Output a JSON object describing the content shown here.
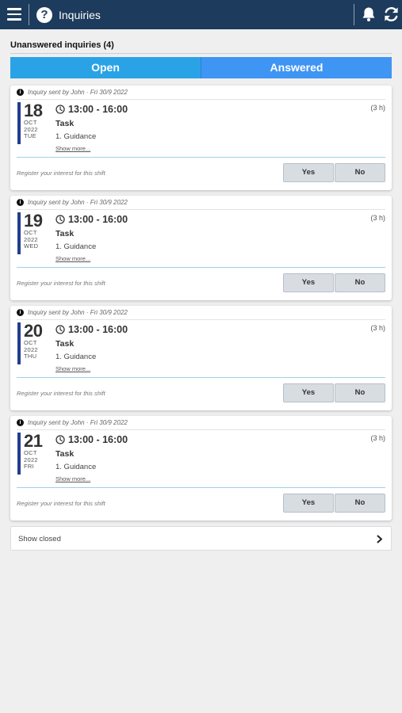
{
  "header": {
    "title": "Inquiries",
    "menu_icon": "hamburger-menu-icon",
    "help_icon": "help-icon",
    "help_glyph": "?",
    "notification_icon": "bell-icon",
    "refresh_icon": "refresh-icon",
    "background_color": "#1d3b5c"
  },
  "section": {
    "title": "Unanswered inquiries (4)"
  },
  "tabs": [
    {
      "label": "Open",
      "color": "#2aa3e6"
    },
    {
      "label": "Answered",
      "color": "#3e95f3"
    }
  ],
  "cards": [
    {
      "sender_note": "Inquiry sent by John · Fri 30/9 2022",
      "day": "18",
      "month": "OCT",
      "year": "2022",
      "weekday": "TUE",
      "time": "13:00 - 16:00",
      "duration": "(3 h)",
      "task": "Task",
      "guidance": "1. Guidance",
      "show_more": "Show more...",
      "register_text": "Register your interest for this shift",
      "yes_label": "Yes",
      "no_label": "No"
    },
    {
      "sender_note": "Inquiry sent by John · Fri 30/9 2022",
      "day": "19",
      "month": "OCT",
      "year": "2022",
      "weekday": "WED",
      "time": "13:00 - 16:00",
      "duration": "(3 h)",
      "task": "Task",
      "guidance": "1. Guidance",
      "show_more": "Show more...",
      "register_text": "Register your interest for this shift",
      "yes_label": "Yes",
      "no_label": "No"
    },
    {
      "sender_note": "Inquiry sent by John · Fri 30/9 2022",
      "day": "20",
      "month": "OCT",
      "year": "2022",
      "weekday": "THU",
      "time": "13:00 - 16:00",
      "duration": "(3 h)",
      "task": "Task",
      "guidance": "1. Guidance",
      "show_more": "Show more...",
      "register_text": "Register your interest for this shift",
      "yes_label": "Yes",
      "no_label": "No"
    },
    {
      "sender_note": "Inquiry sent by John · Fri 30/9 2022",
      "day": "21",
      "month": "OCT",
      "year": "2022",
      "weekday": "FRI",
      "time": "13:00 - 16:00",
      "duration": "(3 h)",
      "task": "Task",
      "guidance": "1. Guidance",
      "show_more": "Show more...",
      "register_text": "Register your interest for this shift",
      "yes_label": "Yes",
      "no_label": "No"
    }
  ],
  "show_closed": {
    "label": "Show closed",
    "icon": "chevron-right-icon"
  },
  "accent_colors": {
    "date_bar": "#233d8f",
    "divider": "#9ed0ef"
  }
}
